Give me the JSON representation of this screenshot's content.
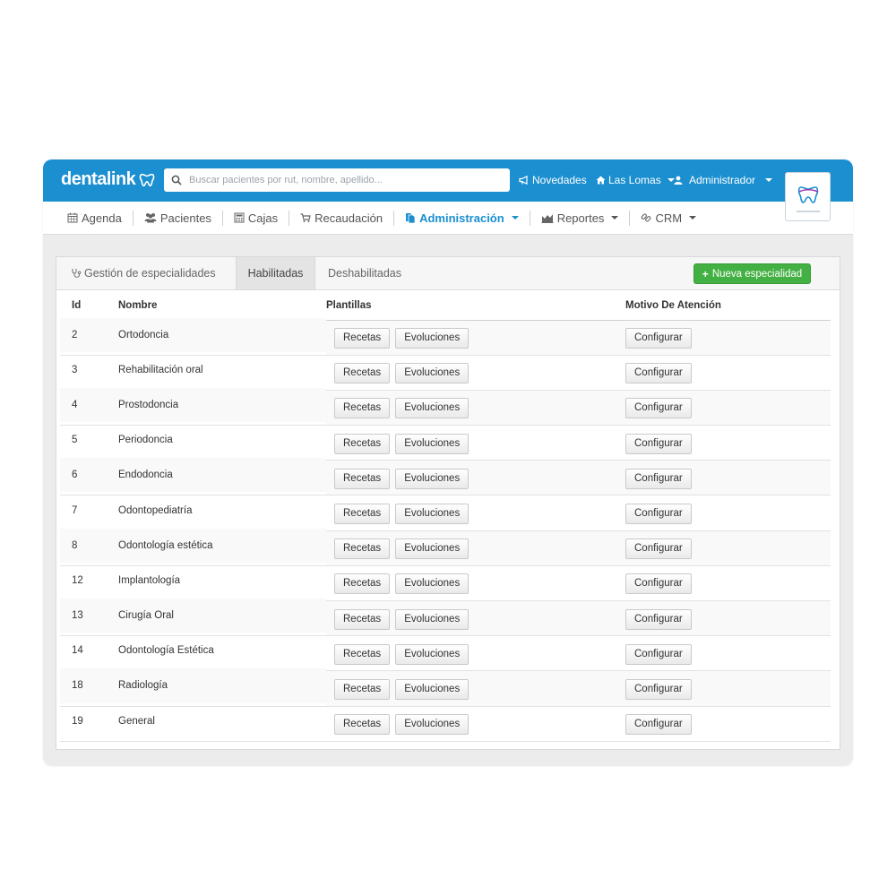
{
  "brand": {
    "name": "dentalink"
  },
  "search": {
    "placeholder": "Buscar pacientes por rut, nombre, apellido..."
  },
  "topnav": {
    "novedades": "Novedades",
    "location": "Las Lomas",
    "user": "Administrador"
  },
  "menu": [
    {
      "label": "Agenda",
      "icon": "calendar-icon"
    },
    {
      "label": "Pacientes",
      "icon": "users-icon"
    },
    {
      "label": "Cajas",
      "icon": "calculator-icon"
    },
    {
      "label": "Recaudación",
      "icon": "cart-icon"
    },
    {
      "label": "Administración",
      "icon": "files-icon",
      "active": true
    },
    {
      "label": "Reportes",
      "icon": "area-chart-icon"
    },
    {
      "label": "CRM",
      "icon": "link-icon"
    }
  ],
  "tabs": {
    "title": "Gestión de especialidades",
    "habilitadas": "Habilitadas",
    "deshabilitadas": "Deshabilitadas",
    "new_button": "Nueva especialidad"
  },
  "table": {
    "headers": {
      "id": "Id",
      "nombre": "Nombre",
      "plantillas": "Plantillas",
      "motivo": "Motivo De Atención"
    },
    "buttons": {
      "recetas": "Recetas",
      "evoluciones": "Evoluciones",
      "configurar": "Configurar"
    },
    "rows": [
      {
        "id": "2",
        "nombre": "Ortodoncia"
      },
      {
        "id": "3",
        "nombre": "Rehabilitación oral"
      },
      {
        "id": "4",
        "nombre": "Prostodoncia"
      },
      {
        "id": "5",
        "nombre": "Periodoncia"
      },
      {
        "id": "6",
        "nombre": "Endodoncia"
      },
      {
        "id": "7",
        "nombre": "Odontopediatría"
      },
      {
        "id": "8",
        "nombre": "Odontología estética"
      },
      {
        "id": "12",
        "nombre": "Implantología"
      },
      {
        "id": "13",
        "nombre": "Cirugía Oral"
      },
      {
        "id": "14",
        "nombre": "Odontología Estética"
      },
      {
        "id": "18",
        "nombre": "Radiología"
      },
      {
        "id": "19",
        "nombre": "General"
      }
    ]
  },
  "colors": {
    "brand_blue": "#1b8fd0",
    "success_green": "#43b043"
  }
}
